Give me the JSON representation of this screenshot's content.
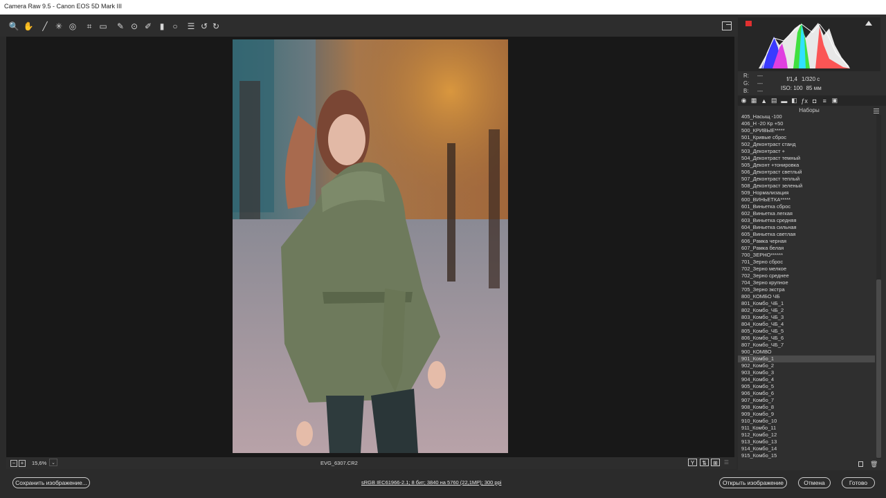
{
  "window": {
    "title": "Camera Raw 9.5  -  Canon EOS 5D Mark III"
  },
  "toolbar": {
    "tools": [
      {
        "name": "zoom-icon",
        "glyph": "🔍"
      },
      {
        "name": "hand-icon",
        "glyph": "✋"
      },
      {
        "name": "eyedropper-icon",
        "glyph": "╱"
      },
      {
        "name": "color-sampler-icon",
        "glyph": "✳"
      },
      {
        "name": "target-adjust-icon",
        "glyph": "◎"
      },
      {
        "name": "crop-icon",
        "glyph": "⌗"
      },
      {
        "name": "straighten-icon",
        "glyph": "▭"
      },
      {
        "name": "spot-removal-icon",
        "glyph": "✎"
      },
      {
        "name": "red-eye-icon",
        "glyph": "⊙"
      },
      {
        "name": "adjustment-brush-icon",
        "glyph": "✐"
      },
      {
        "name": "graduated-filter-icon",
        "glyph": "▮"
      },
      {
        "name": "radial-filter-icon",
        "glyph": "○"
      },
      {
        "name": "preferences-icon",
        "glyph": "☰"
      },
      {
        "name": "rotate-ccw-icon",
        "glyph": "↺"
      },
      {
        "name": "rotate-cw-icon",
        "glyph": "↻"
      }
    ]
  },
  "image": {
    "filename": "EVG_6307.CR2"
  },
  "zoom": {
    "level": "15,6%"
  },
  "meta": {
    "r_label": "R:",
    "g_label": "G:",
    "b_label": "B:",
    "r_val": "---",
    "g_val": "---",
    "b_val": "---",
    "aperture": "f/1,4",
    "shutter": "1/320 с",
    "iso": "ISO: 100",
    "focal": "85 мм"
  },
  "presets": {
    "title": "Наборы",
    "selected_index": 35,
    "items": [
      "405_Насыщ -100",
      "406_Н -20 Кр +50",
      "500_КРИВЫЕ*****",
      "501_Кривые сброс",
      "502_Деконтраст станд",
      "503_Деконтраст +",
      "504_Деконтраст темный",
      "505_Деконт +тонировка",
      "506_Деконтраст светлый",
      "507_Деконтраст теплый",
      "508_Деконтраст зеленый",
      "509_Нормализация",
      "600_ВИНЬЕТКА*****",
      "601_Виньетка сброс",
      "602_Виньетка легкая",
      "603_Виньетка средняя",
      "604_Виньетка сильная",
      "605_Виньетка светлая",
      "606_Рамка черная",
      "607_Рамка белая",
      "700_ЗЕРНО******",
      "701_Зерно сброс",
      "702_Зерно мелкое",
      "702_Зерно среднее",
      "704_Зерно крупное",
      "705_Зерно экстра",
      "800_КОМБО ЧБ",
      "801_Комбо_ЧБ_1",
      "802_Комбо_ЧБ_2",
      "803_Комбо_ЧБ_3",
      "804_Комбо_ЧБ_4",
      "805_Комбо_ЧБ_5",
      "806_Комбо_ЧБ_6",
      "807_Комбо_ЧБ_7",
      "900_КОМВО",
      "901_Комбо_1",
      "902_Комбо_2",
      "903_Комбо_3",
      "904_Комбо_4",
      "905_Комбо_5",
      "906_Комбо_6",
      "907_Комбо_7",
      "908_Комбо_8",
      "909_Комбо_9",
      "910_Комбо_10",
      "911_Комбо_11",
      "912_Комбо_12",
      "913_Комбо_13",
      "914_Комбо_14",
      "915_Комбо_15"
    ]
  },
  "footer": {
    "save_label": "Сохранить изображение...",
    "workflow_link": "sRGB IEC61966-2.1; 8 бит; 3840 на 5760 (22,1MP); 300 ppi",
    "open_label": "Открыть изображение",
    "cancel_label": "Отмена",
    "done_label": "Готово"
  },
  "colors": {
    "accent_red": "#e03030",
    "panel": "#2f2f2f",
    "canvas": "#181818"
  }
}
